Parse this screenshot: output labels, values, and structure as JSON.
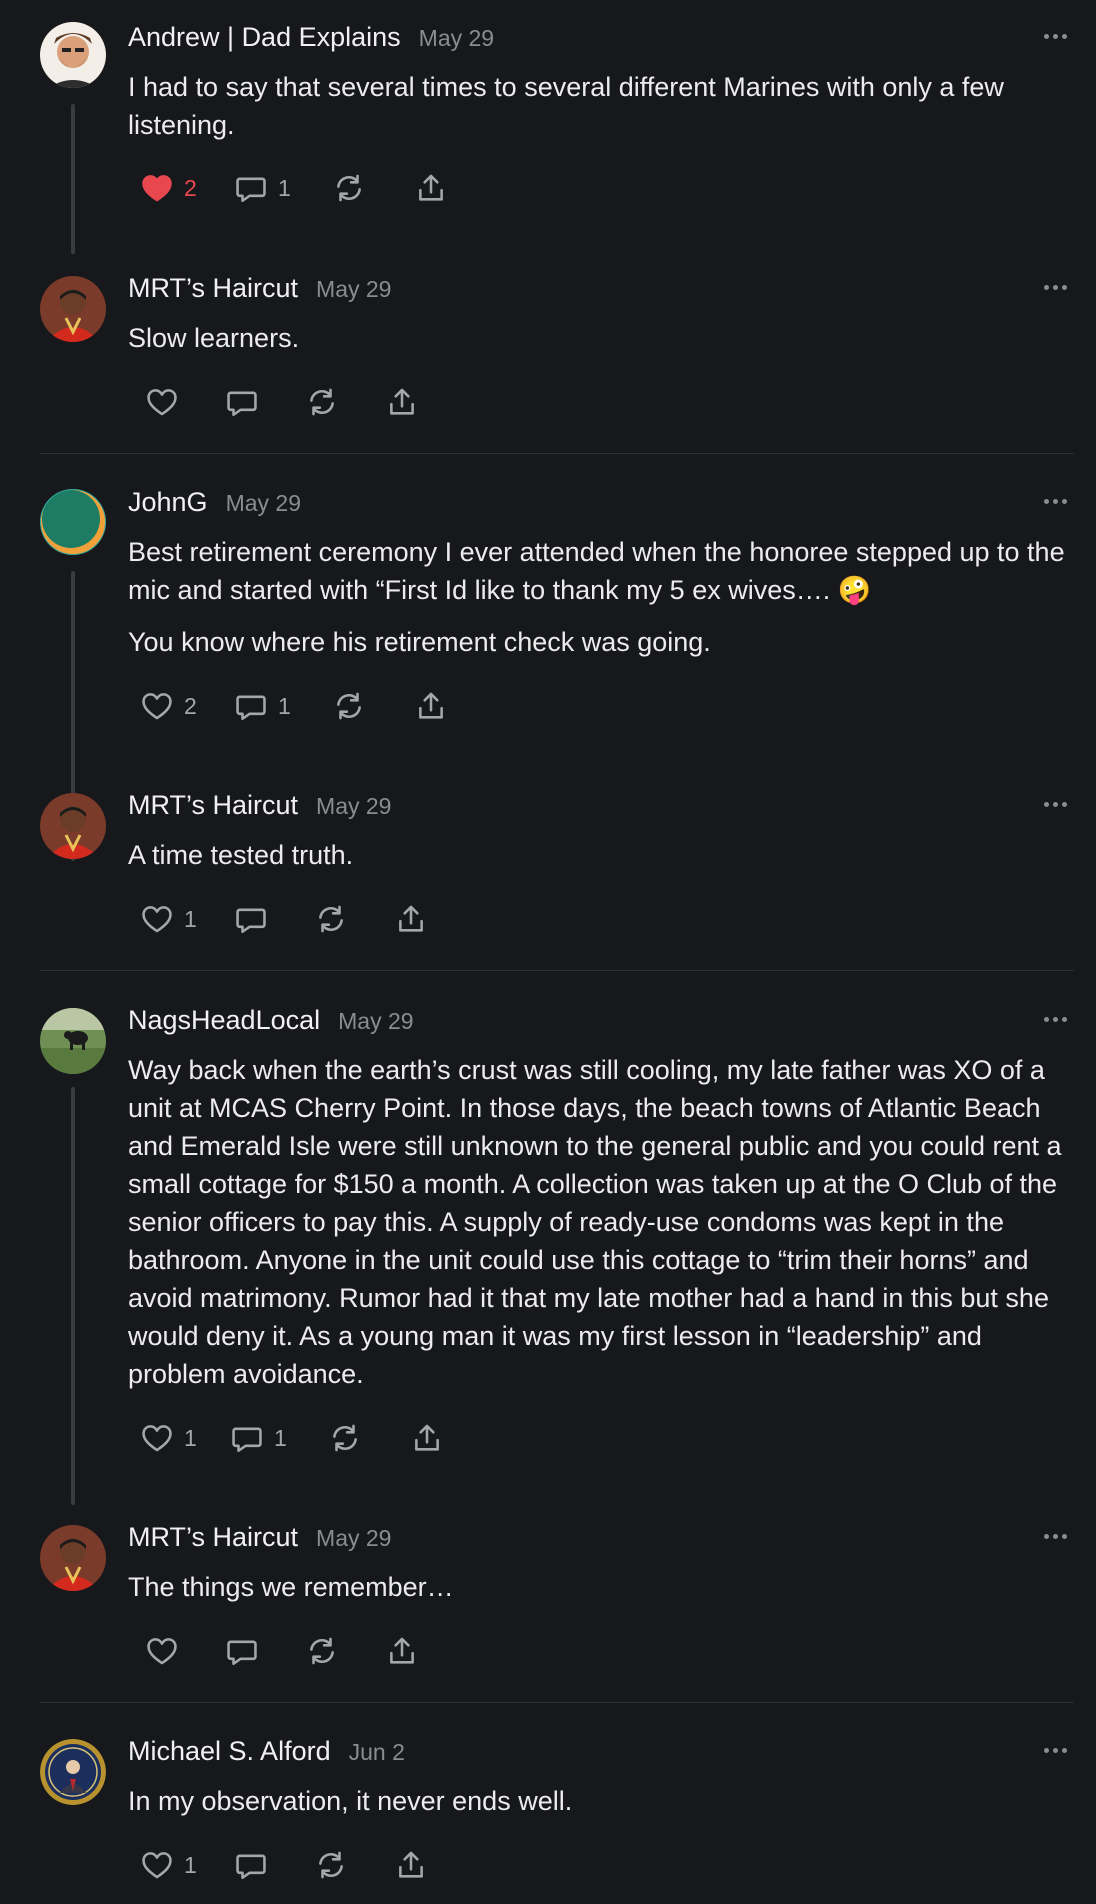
{
  "colors": {
    "background": "#17181b",
    "like_active": "#e8474f",
    "muted": "#8b8c90"
  },
  "comments": [
    {
      "author": "Andrew | Dad Explains",
      "date": "May 29",
      "text": [
        "I had to say that several times to several different Marines with only a few listening."
      ],
      "likes": "2",
      "replies": "1",
      "liked": true
    },
    {
      "author": "MRT’s Haircut",
      "date": "May 29",
      "text": [
        "Slow learners."
      ],
      "likes": "",
      "replies": ""
    },
    {
      "author": "JohnG",
      "date": "May 29",
      "text": [
        "Best retirement ceremony I ever attended when the honoree stepped up to the mic and started with “First Id like to thank my 5 ex wives…. 🤪",
        "You know where his retirement check was going."
      ],
      "likes": "2",
      "replies": "1"
    },
    {
      "author": "MRT’s Haircut",
      "date": "May 29",
      "text": [
        "A time tested truth."
      ],
      "likes": "1",
      "replies": ""
    },
    {
      "author": "NagsHeadLocal",
      "date": "May 29",
      "text": [
        "Way back when the earth’s crust was still cooling, my late father was XO of a unit at MCAS Cherry Point. In those days, the beach towns of Atlantic Beach and Emerald Isle were still unknown to the general public and you could rent a small cottage for $150 a month. A collection was taken up at the O Club of the senior officers to pay this. A supply of ready-use condoms was kept in the bathroom. Anyone in the unit could use this cottage to “trim their horns” and avoid matrimony. Rumor had it that my late mother had a hand in this but she would deny it. As a young man it was my first lesson in “leadership” and problem avoidance."
      ],
      "likes": "1",
      "replies": "1"
    },
    {
      "author": "MRT’s Haircut",
      "date": "May 29",
      "text": [
        "The things we remember…"
      ],
      "likes": "",
      "replies": ""
    },
    {
      "author": "Michael S. Alford",
      "date": "Jun 2",
      "text": [
        "In my observation, it never ends well."
      ],
      "likes": "1",
      "replies": ""
    }
  ]
}
